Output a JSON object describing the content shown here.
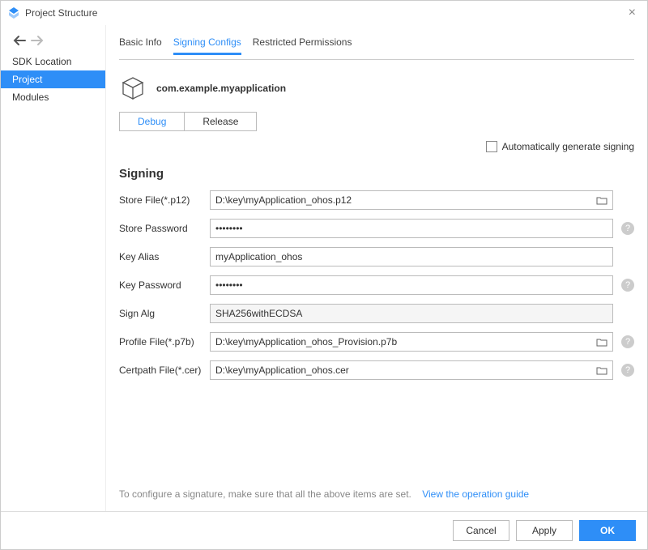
{
  "window": {
    "title": "Project Structure"
  },
  "sidebar": {
    "items": [
      {
        "label": "SDK Location"
      },
      {
        "label": "Project"
      },
      {
        "label": "Modules"
      }
    ]
  },
  "tabs": [
    {
      "label": "Basic Info"
    },
    {
      "label": "Signing Configs"
    },
    {
      "label": "Restricted Permissions"
    }
  ],
  "package_name": "com.example.myapplication",
  "modes": {
    "debug": "Debug",
    "release": "Release"
  },
  "auto_generate_label": "Automatically generate signing",
  "section_title": "Signing",
  "fields": {
    "store_file": {
      "label": "Store File(*.p12)",
      "value": "D:\\key\\myApplication_ohos.p12"
    },
    "store_pw": {
      "label": "Store Password",
      "value": "••••••••"
    },
    "key_alias": {
      "label": "Key Alias",
      "value": "myApplication_ohos"
    },
    "key_pw": {
      "label": "Key Password",
      "value": "••••••••"
    },
    "sign_alg": {
      "label": "Sign Alg",
      "value": "SHA256withECDSA"
    },
    "profile": {
      "label": "Profile File(*.p7b)",
      "value": "D:\\key\\myApplication_ohos_Provision.p7b"
    },
    "certpath": {
      "label": "Certpath File(*.cer)",
      "value": "D:\\key\\myApplication_ohos.cer"
    }
  },
  "footer": {
    "note": "To configure a signature, make sure that all the above items are set.",
    "link": "View the operation guide"
  },
  "buttons": {
    "cancel": "Cancel",
    "apply": "Apply",
    "ok": "OK"
  }
}
